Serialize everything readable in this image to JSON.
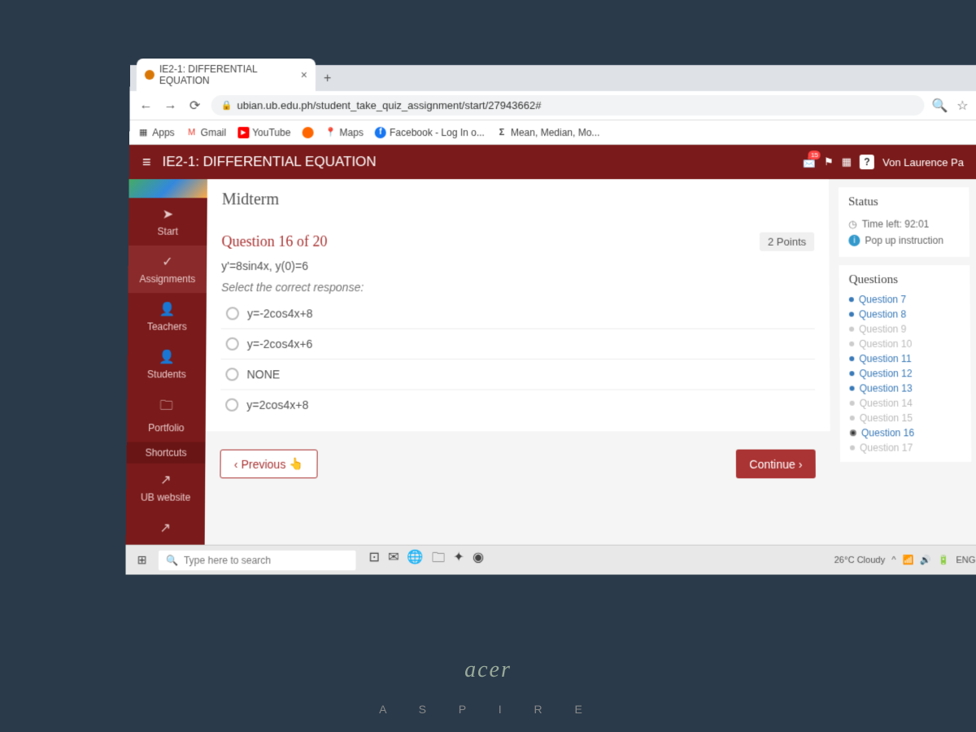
{
  "browser": {
    "tab_title": "IE2-1: DIFFERENTIAL EQUATION",
    "url": "ubian.ub.edu.ph/student_take_quiz_assignment/start/27943662#",
    "bookmarks": {
      "apps": "Apps",
      "gmail": "Gmail",
      "youtube": "YouTube",
      "maps": "Maps",
      "facebook": "Facebook - Log In o...",
      "mean": "Mean, Median, Mo..."
    }
  },
  "header": {
    "title": "IE2-1: DIFFERENTIAL EQUATION",
    "notif_count": "15",
    "user": "Von Laurence Pa"
  },
  "sidebar": {
    "start": "Start",
    "assignments": "Assignments",
    "teachers": "Teachers",
    "students": "Students",
    "portfolio": "Portfolio",
    "shortcuts": "Shortcuts",
    "ub": "UB website"
  },
  "section": "Midterm",
  "question": {
    "title": "Question 16 of 20",
    "points": "2 Points",
    "equation": "y'=8sin4x, y(0)=6",
    "instruction": "Select the correct response:",
    "options": {
      "a": "y=-2cos4x+8",
      "b": "y=-2cos4x+6",
      "c": "NONE",
      "d": "y=2cos4x+8"
    },
    "prev": "Previous",
    "next": "Continue"
  },
  "status": {
    "heading": "Status",
    "time_left": "Time left: 92:01",
    "popup": "Pop up instruction"
  },
  "qlist": {
    "heading": "Questions",
    "items": [
      "Question 7",
      "Question 8",
      "Question 9",
      "Question 10",
      "Question 11",
      "Question 12",
      "Question 13",
      "Question 14",
      "Question 15",
      "Question 16",
      "Question 17"
    ]
  },
  "taskbar": {
    "search": "Type here to search",
    "weather": "26°C Cloudy",
    "lang": "ENG"
  },
  "laptop_brand": "acer",
  "kbd": "A S P I R E"
}
